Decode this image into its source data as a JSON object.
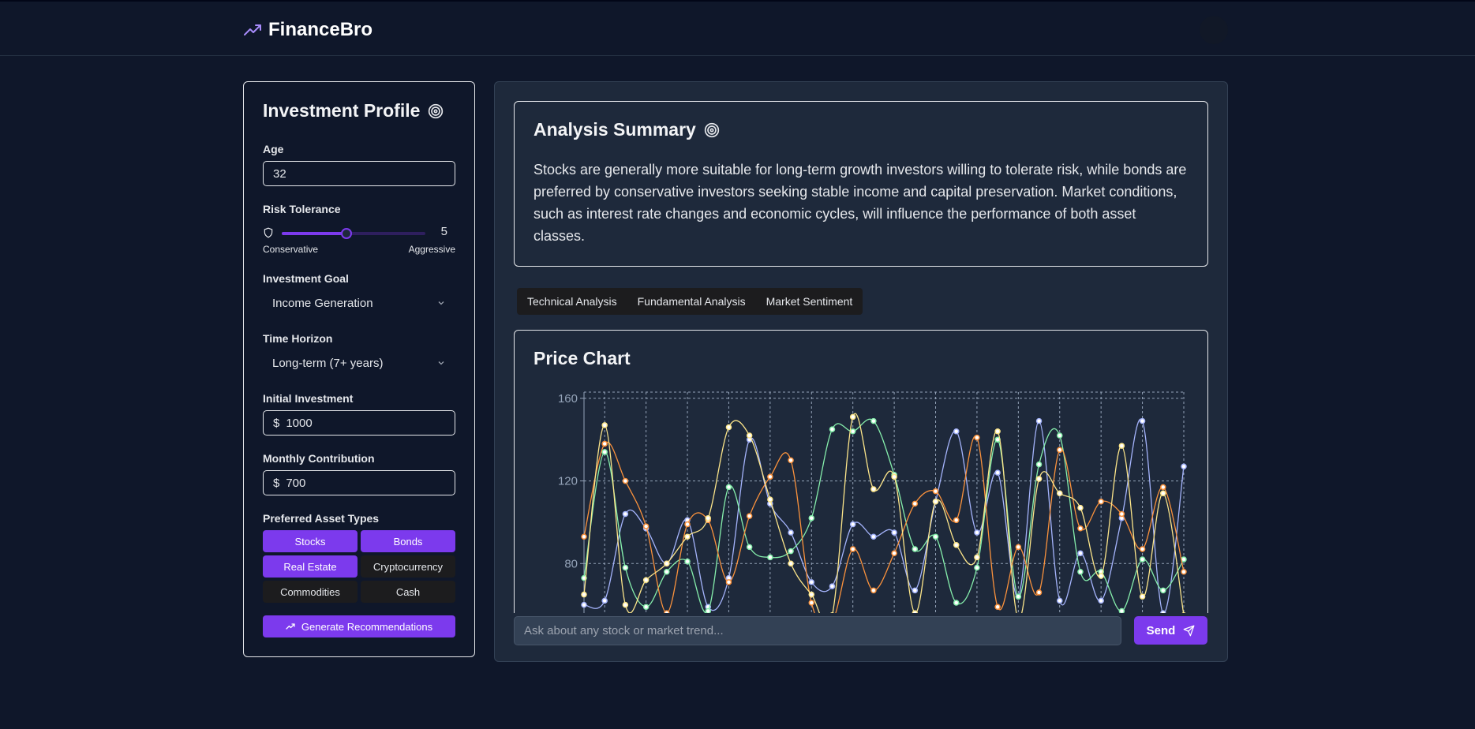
{
  "header": {
    "brand": "FinanceBro"
  },
  "colors": {
    "accent": "#7c3aed",
    "bg": "#0f172a",
    "panel": "#1e293b"
  },
  "profile": {
    "title": "Investment Profile",
    "age": {
      "label": "Age",
      "value": "32"
    },
    "risk": {
      "label": "Risk Tolerance",
      "value": "5",
      "level": 0.45,
      "min_label": "Conservative",
      "max_label": "Aggressive"
    },
    "goal": {
      "label": "Investment Goal",
      "value": "Income Generation"
    },
    "horizon": {
      "label": "Time Horizon",
      "value": "Long-term (7+ years)"
    },
    "initial": {
      "label": "Initial Investment",
      "currency": "$",
      "value": "1000"
    },
    "monthly": {
      "label": "Monthly Contribution",
      "currency": "$",
      "value": "700"
    },
    "assets": {
      "label": "Preferred Asset Types",
      "items": [
        {
          "label": "Stocks",
          "selected": true
        },
        {
          "label": "Bonds",
          "selected": true
        },
        {
          "label": "Real Estate",
          "selected": true
        },
        {
          "label": "Cryptocurrency",
          "selected": false
        },
        {
          "label": "Commodities",
          "selected": false
        },
        {
          "label": "Cash",
          "selected": false
        }
      ]
    },
    "generate_label": "Generate Recommendations"
  },
  "summary": {
    "title": "Analysis Summary",
    "body": "Stocks are generally more suitable for long-term growth investors willing to tolerate risk, while bonds are preferred by conservative investors seeking stable income and capital preservation. Market conditions, such as interest rate changes and economic cycles, will influence the performance of both asset classes."
  },
  "tabs": [
    "Technical Analysis",
    "Fundamental Analysis",
    "Market Sentiment"
  ],
  "chart": {
    "title": "Price Chart"
  },
  "chart_data": {
    "type": "line",
    "title": "Price Chart",
    "xlabel": "",
    "ylabel": "",
    "yticks": [
      80,
      120,
      160
    ],
    "ylim": [
      40,
      163
    ],
    "grid": true,
    "legend": "none",
    "x": [
      0,
      1,
      2,
      3,
      4,
      5,
      6,
      7,
      8,
      9,
      10,
      11,
      12,
      13,
      14,
      15,
      16,
      17,
      18,
      19,
      20,
      21,
      22,
      23,
      24,
      25,
      26,
      27,
      28,
      29
    ],
    "series": [
      {
        "color": "#a5b4fc",
        "values": [
          60,
          62,
          104,
          97,
          80,
          101,
          59,
          73,
          140,
          109,
          95,
          71,
          69,
          99,
          93,
          95,
          67,
          110,
          144,
          95,
          124,
          64,
          149,
          62,
          85,
          62,
          102,
          149,
          56,
          127
        ]
      },
      {
        "color": "#86efac",
        "values": [
          73,
          134,
          78,
          59,
          76,
          81,
          57,
          117,
          88,
          83,
          86,
          102,
          145,
          144,
          149,
          123,
          87,
          93,
          61,
          78,
          140,
          64,
          128,
          142,
          76,
          76,
          57,
          82,
          67,
          82
        ]
      },
      {
        "color": "#fb923c",
        "values": [
          93,
          138,
          120,
          98,
          56,
          99,
          101,
          71,
          103,
          122,
          130,
          61,
          52,
          87,
          67,
          85,
          109,
          115,
          101,
          141,
          59,
          88,
          66,
          135,
          97,
          110,
          104,
          87,
          117,
          76
        ]
      },
      {
        "color": "#fde68a",
        "values": [
          65,
          147,
          60,
          72,
          80,
          93,
          102,
          146,
          142,
          111,
          80,
          65,
          55,
          151,
          116,
          122,
          56,
          110,
          89,
          83,
          144,
          53,
          121,
          114,
          107,
          74,
          137,
          64,
          114,
          55
        ]
      }
    ]
  },
  "chat": {
    "placeholder": "Ask about any stock or market trend...",
    "send_label": "Send"
  }
}
